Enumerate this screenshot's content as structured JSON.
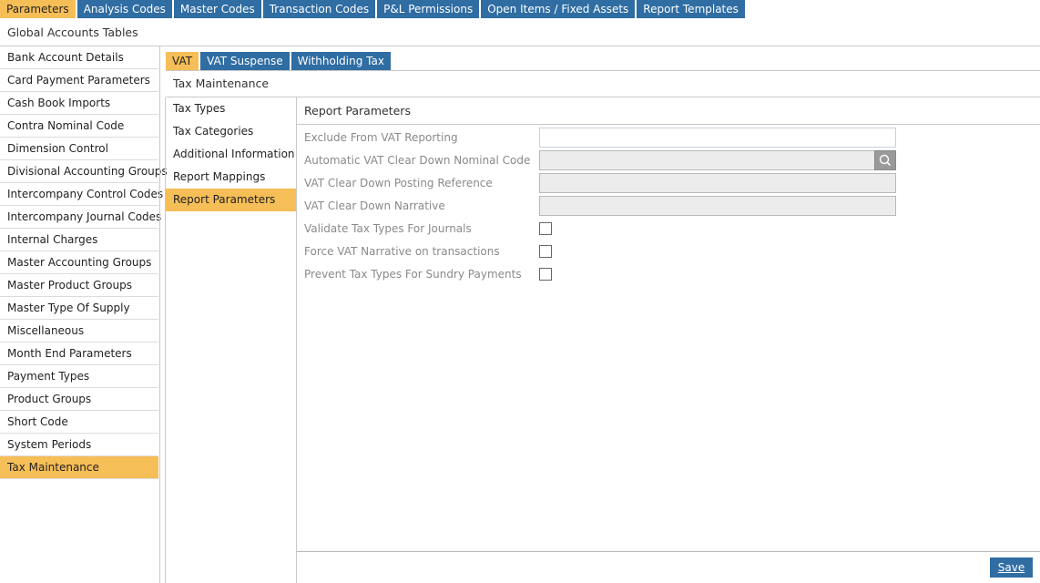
{
  "topnav": {
    "tabs": [
      {
        "label": "Parameters",
        "active": true
      },
      {
        "label": "Analysis Codes",
        "active": false
      },
      {
        "label": "Master Codes",
        "active": false
      },
      {
        "label": "Transaction Codes",
        "active": false
      },
      {
        "label": "P&L Permissions",
        "active": false
      },
      {
        "label": "Open Items / Fixed Assets",
        "active": false
      },
      {
        "label": "Report Templates",
        "active": false
      }
    ]
  },
  "section_title": "Global Accounts Tables",
  "sidebar": {
    "items": [
      {
        "label": "Bank Account Details"
      },
      {
        "label": "Card Payment Parameters"
      },
      {
        "label": "Cash Book Imports"
      },
      {
        "label": "Contra Nominal Code"
      },
      {
        "label": "Dimension Control"
      },
      {
        "label": "Divisional Accounting Groups"
      },
      {
        "label": "Intercompany Control Codes"
      },
      {
        "label": "Intercompany Journal Codes"
      },
      {
        "label": "Internal Charges"
      },
      {
        "label": "Master Accounting Groups"
      },
      {
        "label": "Master Product Groups"
      },
      {
        "label": "Master Type Of Supply"
      },
      {
        "label": "Miscellaneous"
      },
      {
        "label": "Month End Parameters"
      },
      {
        "label": "Payment Types"
      },
      {
        "label": "Product Groups"
      },
      {
        "label": "Short Code"
      },
      {
        "label": "System Periods"
      },
      {
        "label": "Tax Maintenance",
        "active": true
      }
    ]
  },
  "subtabs": [
    {
      "label": "VAT",
      "active": true
    },
    {
      "label": "VAT Suspense",
      "active": false
    },
    {
      "label": "Withholding Tax",
      "active": false
    }
  ],
  "tax_maintenance_title": "Tax Maintenance",
  "midnav": {
    "items": [
      {
        "label": "Tax Types"
      },
      {
        "label": "Tax Categories"
      },
      {
        "label": "Additional Information"
      },
      {
        "label": "Report Mappings"
      },
      {
        "label": "Report Parameters",
        "active": true
      }
    ]
  },
  "report_parameters": {
    "title": "Report Parameters",
    "fields": {
      "exclude_from_vat_reporting": {
        "label": "Exclude From VAT Reporting",
        "value": ""
      },
      "auto_clear_down_nominal": {
        "label": "Automatic VAT Clear Down Nominal Code",
        "value": ""
      },
      "clear_down_posting_ref": {
        "label": "VAT Clear Down Posting Reference",
        "value": ""
      },
      "clear_down_narrative": {
        "label": "VAT Clear Down Narrative",
        "value": ""
      },
      "validate_tax_types_journals": {
        "label": "Validate Tax Types For Journals",
        "checked": false
      },
      "force_vat_narrative": {
        "label": "Force VAT Narrative on transactions",
        "checked": false
      },
      "prevent_tax_types_sundry": {
        "label": "Prevent Tax Types For Sundry Payments",
        "checked": false
      }
    }
  },
  "footer": {
    "save_label": "Save"
  },
  "colors": {
    "accent_blue": "#2f6da3",
    "active_orange": "#f6be57",
    "label_gray": "#8a8a8a"
  },
  "icons": {
    "lookup": "search-icon"
  }
}
